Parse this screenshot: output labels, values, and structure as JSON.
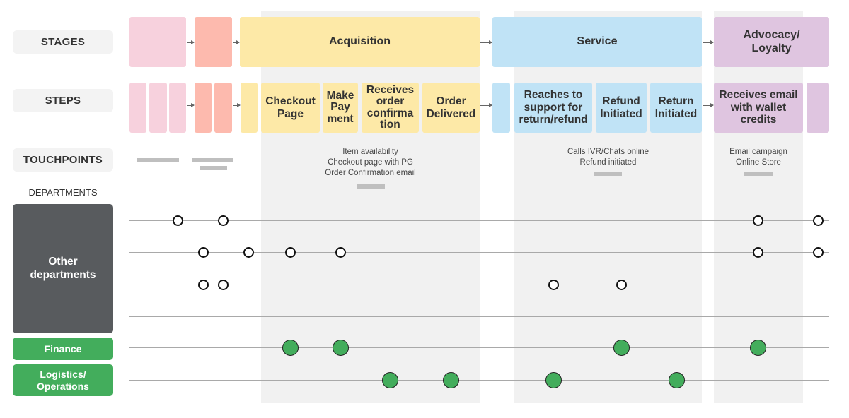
{
  "row_labels": {
    "stages": "STAGES",
    "steps": "STEPS",
    "touchpoints": "TOUCHPOINTS",
    "departments": "DEPARTMENTS"
  },
  "stages": [
    {
      "label": "",
      "color": "#f7d1dd"
    },
    {
      "label": "",
      "color": "#fdbaae"
    },
    {
      "label": "Acquisition",
      "color": "#fde9a7"
    },
    {
      "label": "Service",
      "color": "#c0e3f6"
    },
    {
      "label": "Advocacy/ Loyalty",
      "color": "#dfc5e0"
    }
  ],
  "steps": [
    {
      "label": "",
      "stage": 0
    },
    {
      "label": "",
      "stage": 0
    },
    {
      "label": "",
      "stage": 0
    },
    {
      "label": "",
      "stage": 1
    },
    {
      "label": "",
      "stage": 1
    },
    {
      "label": "",
      "stage": 2
    },
    {
      "label": "Checkout Page",
      "stage": 2
    },
    {
      "label": "Make Pay ment",
      "stage": 2
    },
    {
      "label": "Receives order confirma tion",
      "stage": 2
    },
    {
      "label": "Order Delivered",
      "stage": 2
    },
    {
      "label": "",
      "stage": 3
    },
    {
      "label": "Reaches to support for return/refund",
      "stage": 3
    },
    {
      "label": "Refund Initiated",
      "stage": 3
    },
    {
      "label": "Return Initiated",
      "stage": 3
    },
    {
      "label": "Receives email with wallet credits",
      "stage": 4
    },
    {
      "label": "",
      "stage": 4
    }
  ],
  "touchpoints": {
    "acquisition": [
      "Item availability",
      "Checkout page with PG",
      "Order Confirmation email"
    ],
    "service": [
      "Calls IVR/Chats online",
      "Refund initiated"
    ],
    "advocacy": [
      "Email campaign",
      "Online Store"
    ]
  },
  "departments": [
    {
      "label": "Other departments",
      "color": "#585b5e",
      "lanes": 4
    },
    {
      "label": "Finance",
      "color": "#43ad5c",
      "lanes": 1
    },
    {
      "label": "Logistics/ Operations",
      "color": "#43ad5c",
      "lanes": 1
    }
  ],
  "lanes": [
    {
      "department": "Other departments",
      "type": "hollow",
      "touch_steps": [
        "stage0-step2",
        "stage1-step1",
        "advocacy-step1",
        "advocacy-step2"
      ]
    },
    {
      "department": "Other departments",
      "type": "hollow",
      "touch_steps": [
        "stage1-step1",
        "stage2-step1",
        "Checkout Page",
        "Make Pay ment",
        "advocacy-step1",
        "advocacy-step2"
      ]
    },
    {
      "department": "Other departments",
      "type": "hollow",
      "touch_steps": [
        "stage1-step1",
        "stage1-step2",
        "Reaches to support for return/refund",
        "Refund Initiated"
      ]
    },
    {
      "department": "Other departments",
      "type": "hollow",
      "touch_steps": []
    },
    {
      "department": "Finance",
      "type": "filled",
      "touch_steps": [
        "Checkout Page",
        "Make Pay ment",
        "Refund Initiated",
        "Receives email with wallet credits"
      ]
    },
    {
      "department": "Logistics/ Operations",
      "type": "filled",
      "touch_steps": [
        "Receives order confirma tion",
        "Order Delivered",
        "Reaches to support for return/refund",
        "Return Initiated"
      ]
    }
  ]
}
